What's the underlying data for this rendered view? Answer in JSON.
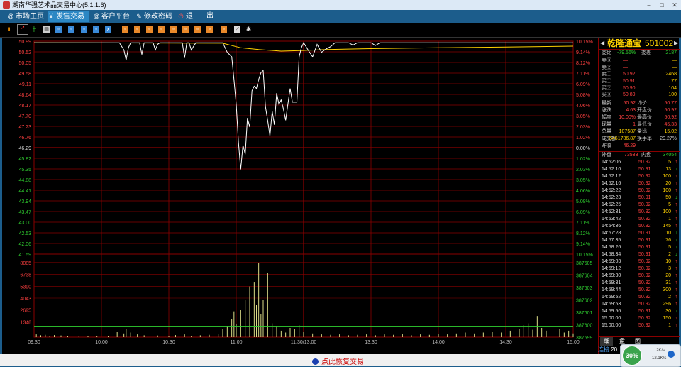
{
  "window": {
    "title": "湖南华强艺术品交易中心(5.1.1.6)"
  },
  "menu": {
    "items": [
      {
        "label": "市场主页",
        "icon": "@"
      },
      {
        "label": "发售交易",
        "icon": "¥"
      },
      {
        "label": "客户平台",
        "icon": "@"
      },
      {
        "label": "修改密码",
        "icon": "✎"
      },
      {
        "label": "退",
        "icon": "⏻"
      },
      {
        "label": "出",
        "icon": ""
      }
    ]
  },
  "stock": {
    "name": "乾隆通宝",
    "code": "501002"
  },
  "quote": {
    "weibi_label": "委比",
    "weibi": "-79.56%",
    "weicha_label": "委差",
    "weicha": "2187",
    "sells": [
      {
        "label": "卖③",
        "price": "—",
        "vol": "—"
      },
      {
        "label": "卖②",
        "price": "—",
        "vol": "—"
      },
      {
        "label": "卖①",
        "price": "50.92",
        "vol": "2468"
      }
    ],
    "buys": [
      {
        "label": "买①",
        "price": "50.91",
        "vol": "77"
      },
      {
        "label": "买②",
        "price": "50.90",
        "vol": "104"
      },
      {
        "label": "买③",
        "price": "50.89",
        "vol": "100"
      }
    ],
    "stats": [
      {
        "l1": "最新",
        "v1": "50.92",
        "l2": "均价",
        "v2": "50.77"
      },
      {
        "l1": "涨跌",
        "v1": "4.63",
        "l2": "开盘价",
        "v2": "50.92"
      },
      {
        "l1": "幅度",
        "v1": "10.00%",
        "l2": "最高价",
        "v2": "50.92"
      },
      {
        "l1": "现量",
        "v1": "1",
        "l2": "最低价",
        "v2": "45.33"
      },
      {
        "l1": "总量",
        "v1": "107587",
        "l2": "量比",
        "v2": "15.02"
      },
      {
        "l1": "成交额",
        "v1": "5461786.87",
        "l2": "换手率",
        "v2": "29.27%"
      },
      {
        "l1": "昨收",
        "v1": "46.29",
        "l2": "",
        "v2": ""
      }
    ],
    "waipan_label": "外盘",
    "waipan": "73533",
    "neipan_label": "内盘",
    "neipan": "34054"
  },
  "ticks": [
    {
      "time": "14:52:06",
      "price": "50.92",
      "vol": "5",
      "dir": "up"
    },
    {
      "time": "14:52:10",
      "price": "50.91",
      "vol": "13",
      "dir": "down"
    },
    {
      "time": "14:52:12",
      "price": "50.92",
      "vol": "100",
      "dir": "up"
    },
    {
      "time": "14:52:16",
      "price": "50.92",
      "vol": "20",
      "dir": "up"
    },
    {
      "time": "14:52:22",
      "price": "50.92",
      "vol": "100",
      "dir": "up"
    },
    {
      "time": "14:52:23",
      "price": "50.91",
      "vol": "50",
      "dir": "down"
    },
    {
      "time": "14:52:25",
      "price": "50.92",
      "vol": "5",
      "dir": "up"
    },
    {
      "time": "14:52:31",
      "price": "50.92",
      "vol": "100",
      "dir": "up"
    },
    {
      "time": "14:53:42",
      "price": "50.92",
      "vol": "1",
      "dir": "up"
    },
    {
      "time": "14:54:36",
      "price": "50.92",
      "vol": "145",
      "dir": "up"
    },
    {
      "time": "14:57:28",
      "price": "50.91",
      "vol": "10",
      "dir": "down"
    },
    {
      "time": "14:57:35",
      "price": "50.91",
      "vol": "76",
      "dir": "down"
    },
    {
      "time": "14:58:26",
      "price": "50.91",
      "vol": "5",
      "dir": "down"
    },
    {
      "time": "14:58:34",
      "price": "50.91",
      "vol": "2",
      "dir": "down"
    },
    {
      "time": "14:59:03",
      "price": "50.92",
      "vol": "10",
      "dir": "up"
    },
    {
      "time": "14:59:12",
      "price": "50.92",
      "vol": "3",
      "dir": "up"
    },
    {
      "time": "14:59:30",
      "price": "50.92",
      "vol": "20",
      "dir": "up"
    },
    {
      "time": "14:59:31",
      "price": "50.92",
      "vol": "31",
      "dir": "up"
    },
    {
      "time": "14:59:44",
      "price": "50.92",
      "vol": "300",
      "dir": "up"
    },
    {
      "time": "14:59:52",
      "price": "50.92",
      "vol": "2",
      "dir": "up"
    },
    {
      "time": "14:59:53",
      "price": "50.92",
      "vol": "296",
      "dir": "up"
    },
    {
      "time": "14:59:56",
      "price": "50.91",
      "vol": "30",
      "dir": "down"
    },
    {
      "time": "15:00:00",
      "price": "50.92",
      "vol": "150",
      "dir": "up"
    },
    {
      "time": "15:00:00",
      "price": "50.92",
      "vol": "1",
      "dir": "up"
    }
  ],
  "panel_tabs": [
    "细",
    "盘",
    "图"
  ],
  "status": {
    "resume": "点此恢复交易",
    "connect": "连接",
    "connect_num": "20"
  },
  "speed": {
    "percent": "30%",
    "up": "2K/s",
    "down": "12.1K/s"
  },
  "colors": {
    "up": "#ff4040",
    "down": "#30d030",
    "price_line": "#ffffff",
    "avg_line": "#ffd200",
    "grid": "#8b0000"
  },
  "chart_data": {
    "type": "line",
    "prev_close": 46.29,
    "price_ticks_left": [
      "50.99",
      "50.52",
      "50.05",
      "49.58",
      "49.11",
      "48.64",
      "48.17",
      "47.70",
      "47.23",
      "46.76",
      "46.29",
      "45.82",
      "45.35",
      "44.88",
      "44.41",
      "43.94",
      "43.47",
      "43.00",
      "42.53",
      "42.06",
      "41.59"
    ],
    "pct_ticks_right": [
      "10.15%",
      "9.14%",
      "8.12%",
      "7.11%",
      "6.09%",
      "5.08%",
      "4.06%",
      "3.05%",
      "2.03%",
      "1.02%",
      "0.00%",
      "1.02%",
      "2.03%",
      "3.05%",
      "4.06%",
      "5.08%",
      "6.09%",
      "7.11%",
      "8.12%",
      "9.14%",
      "10.15%"
    ],
    "vol_ticks_left": [
      "8085",
      "6738",
      "5390",
      "4043",
      "2695",
      "1348"
    ],
    "vol_ticks_right": [
      "387605",
      "387604",
      "387603",
      "387602",
      "387601",
      "387600",
      "387599"
    ],
    "x_labels": [
      "09:30",
      "10:00",
      "10:30",
      "11:00",
      "11:30/13:00",
      "13:30",
      "14:00",
      "14:30",
      "15:00"
    ],
    "ylim": [
      41.59,
      50.99
    ],
    "vol_max": 8085,
    "minutes": 240,
    "price_series": [
      [
        0,
        50.92
      ],
      [
        38,
        50.92
      ],
      [
        40,
        50.6
      ],
      [
        41,
        50.15
      ],
      [
        42,
        50.7
      ],
      [
        43,
        50.92
      ],
      [
        47,
        50.92
      ],
      [
        48,
        50.4
      ],
      [
        49,
        50.92
      ],
      [
        53,
        50.92
      ],
      [
        54,
        50.6
      ],
      [
        55,
        50.85
      ],
      [
        56,
        50.92
      ],
      [
        66,
        50.92
      ],
      [
        67,
        50.25
      ],
      [
        68,
        50.92
      ],
      [
        69,
        50.92
      ],
      [
        70,
        50.6
      ],
      [
        72,
        50.92
      ],
      [
        84,
        50.92
      ],
      [
        86,
        50.5
      ],
      [
        88,
        50.3
      ],
      [
        89,
        49.3
      ],
      [
        90,
        48.2
      ],
      [
        91,
        46.5
      ],
      [
        92,
        45.33
      ],
      [
        93,
        46.4
      ],
      [
        94,
        46.0
      ],
      [
        95,
        47.6
      ],
      [
        96,
        47.2
      ],
      [
        97,
        48.8
      ],
      [
        98,
        49.0
      ],
      [
        99,
        48.9
      ],
      [
        100,
        49.3
      ],
      [
        101,
        49.6
      ],
      [
        102,
        49.7
      ],
      [
        103,
        48.1
      ],
      [
        104,
        47.5
      ],
      [
        105,
        46.8
      ],
      [
        106,
        47.9
      ],
      [
        107,
        47.3
      ],
      [
        108,
        48.7
      ],
      [
        109,
        48.2
      ],
      [
        110,
        48.4
      ],
      [
        111,
        48.0
      ],
      [
        112,
        47.5
      ],
      [
        113,
        48.2
      ],
      [
        114,
        48.9
      ],
      [
        115,
        48.3
      ],
      [
        116,
        48.3
      ],
      [
        117,
        48.3
      ],
      [
        118,
        50.3
      ],
      [
        119,
        50.7
      ],
      [
        120,
        50.92
      ],
      [
        122,
        50.6
      ],
      [
        124,
        50.3
      ],
      [
        126,
        50.85
      ],
      [
        128,
        50.5
      ],
      [
        130,
        50.65
      ],
      [
        132,
        50.75
      ],
      [
        134,
        50.92
      ],
      [
        140,
        50.92
      ],
      [
        142,
        50.82
      ],
      [
        144,
        50.92
      ],
      [
        150,
        50.92
      ],
      [
        152,
        50.8
      ],
      [
        154,
        50.92
      ],
      [
        240,
        50.92
      ]
    ],
    "avg_series": [
      [
        0,
        50.92
      ],
      [
        84,
        50.9
      ],
      [
        92,
        50.7
      ],
      [
        100,
        50.62
      ],
      [
        110,
        50.55
      ],
      [
        120,
        50.58
      ],
      [
        130,
        50.62
      ],
      [
        150,
        50.66
      ],
      [
        180,
        50.7
      ],
      [
        210,
        50.73
      ],
      [
        240,
        50.77
      ]
    ],
    "volume_series": [
      [
        1,
        300
      ],
      [
        3,
        200
      ],
      [
        5,
        250
      ],
      [
        7,
        150
      ],
      [
        9,
        220
      ],
      [
        12,
        180
      ],
      [
        15,
        120
      ],
      [
        20,
        100
      ],
      [
        24,
        150
      ],
      [
        28,
        90
      ],
      [
        33,
        130
      ],
      [
        37,
        600
      ],
      [
        40,
        400
      ],
      [
        41,
        900
      ],
      [
        43,
        500
      ],
      [
        46,
        300
      ],
      [
        49,
        200
      ],
      [
        55,
        180
      ],
      [
        60,
        150
      ],
      [
        63,
        220
      ],
      [
        67,
        300
      ],
      [
        70,
        150
      ],
      [
        74,
        200
      ],
      [
        78,
        250
      ],
      [
        82,
        300
      ],
      [
        84,
        900
      ],
      [
        86,
        1200
      ],
      [
        88,
        2000
      ],
      [
        89,
        2800
      ],
      [
        90,
        1400
      ],
      [
        92,
        3000
      ],
      [
        94,
        4000
      ],
      [
        96,
        5500
      ],
      [
        98,
        6000
      ],
      [
        99,
        3500
      ],
      [
        100,
        8085
      ],
      [
        101,
        2500
      ],
      [
        102,
        4000
      ],
      [
        104,
        7000
      ],
      [
        105,
        6500
      ],
      [
        106,
        1500
      ],
      [
        108,
        1200
      ],
      [
        110,
        700
      ],
      [
        112,
        500
      ],
      [
        114,
        1000
      ],
      [
        116,
        900
      ],
      [
        118,
        1300
      ],
      [
        120,
        600
      ],
      [
        124,
        400
      ],
      [
        128,
        300
      ],
      [
        132,
        250
      ],
      [
        136,
        300
      ],
      [
        140,
        200
      ],
      [
        144,
        250
      ],
      [
        148,
        300
      ],
      [
        152,
        200
      ],
      [
        156,
        300
      ],
      [
        160,
        250
      ],
      [
        164,
        350
      ],
      [
        168,
        200
      ],
      [
        172,
        300
      ],
      [
        176,
        250
      ],
      [
        180,
        350
      ],
      [
        184,
        300
      ],
      [
        188,
        400
      ],
      [
        192,
        500
      ],
      [
        196,
        400
      ],
      [
        200,
        500
      ],
      [
        204,
        600
      ],
      [
        208,
        500
      ],
      [
        212,
        700
      ],
      [
        216,
        900
      ],
      [
        218,
        1300
      ],
      [
        220,
        1500
      ],
      [
        222,
        800
      ],
      [
        224,
        2300
      ],
      [
        226,
        1000
      ],
      [
        228,
        700
      ],
      [
        231,
        600
      ],
      [
        234,
        900
      ],
      [
        236,
        500
      ],
      [
        238,
        700
      ],
      [
        240,
        400
      ]
    ],
    "vol_ref": 1200
  }
}
